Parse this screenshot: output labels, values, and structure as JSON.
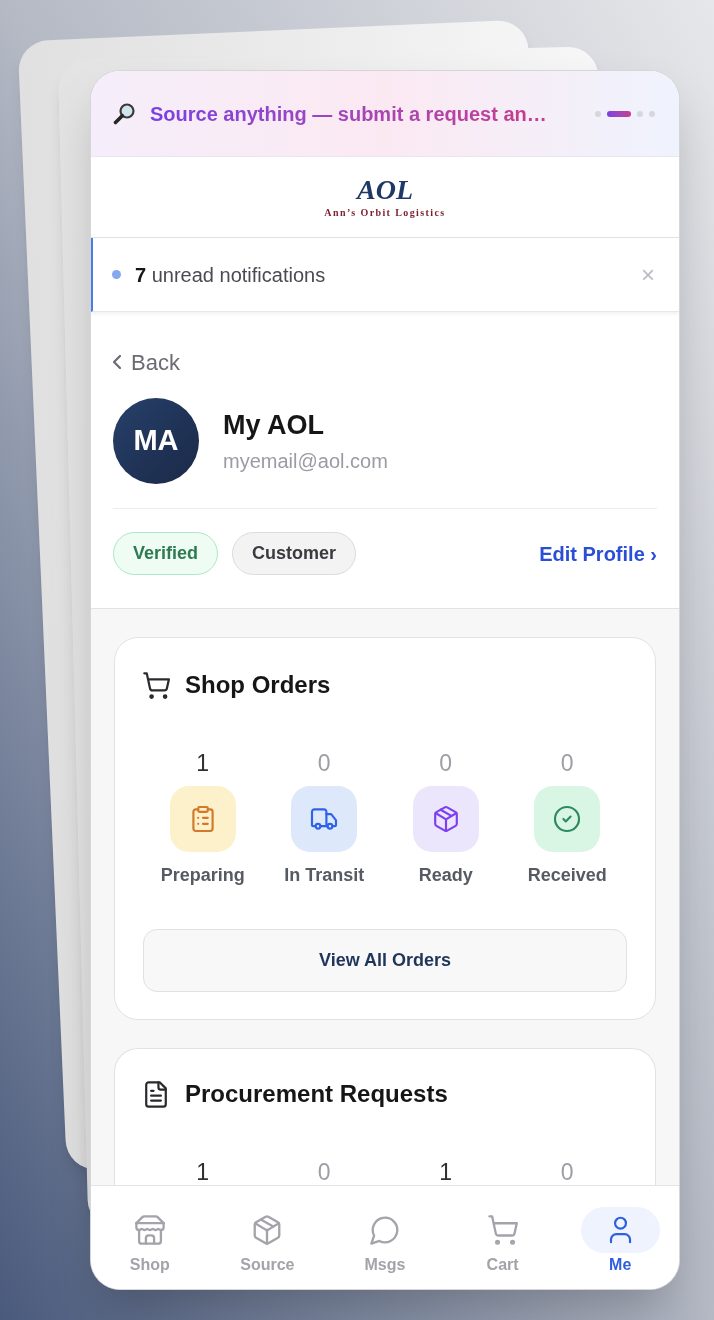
{
  "banner": {
    "text": "Source anything — submit a request an…",
    "dots": [
      {
        "selected": false
      },
      {
        "selected": true
      },
      {
        "selected": false
      },
      {
        "selected": false
      }
    ]
  },
  "logo": {
    "wordmark": "AOL",
    "tagline": "Ann’s Orbit Logistics"
  },
  "notification": {
    "text": "**7** unread notifications",
    "close": "×"
  },
  "profile": {
    "back": "Back",
    "initials": "MA",
    "name": "My AOL",
    "email": "myemail@aol.com",
    "badges": [
      {
        "label": "Verified",
        "kind": "success"
      },
      {
        "label": "Customer",
        "kind": "neutral"
      }
    ],
    "edit_link": "Edit Profile ›"
  },
  "shop_orders": {
    "title": "Shop Orders",
    "stats": [
      {
        "count": "1",
        "dimmed": false,
        "kind": "clipboard",
        "color": "#fcf1cb",
        "label": "Preparing"
      },
      {
        "count": "0",
        "dimmed": true,
        "kind": "truck",
        "color": "#dde8fb",
        "label": "In Transit"
      },
      {
        "count": "0",
        "dimmed": true,
        "kind": "box",
        "color": "#ebe6fb",
        "label": "Ready"
      },
      {
        "count": "0",
        "dimmed": true,
        "kind": "check",
        "color": "#d9f6e5",
        "label": "Received"
      }
    ],
    "button": "View All Orders"
  },
  "procurement": {
    "title": "Procurement Requests",
    "stats": [
      {
        "count": "1",
        "dimmed": false
      },
      {
        "count": "0",
        "dimmed": true
      },
      {
        "count": "1",
        "dimmed": false
      },
      {
        "count": "0",
        "dimmed": true
      }
    ]
  },
  "nav": [
    {
      "label": "Shop",
      "kind": "store",
      "selected": false
    },
    {
      "label": "Source",
      "kind": "box",
      "selected": false
    },
    {
      "label": "Msgs",
      "kind": "chat",
      "selected": false
    },
    {
      "label": "Cart",
      "kind": "cart",
      "selected": false
    },
    {
      "label": "Me",
      "kind": "person",
      "selected": true
    }
  ]
}
